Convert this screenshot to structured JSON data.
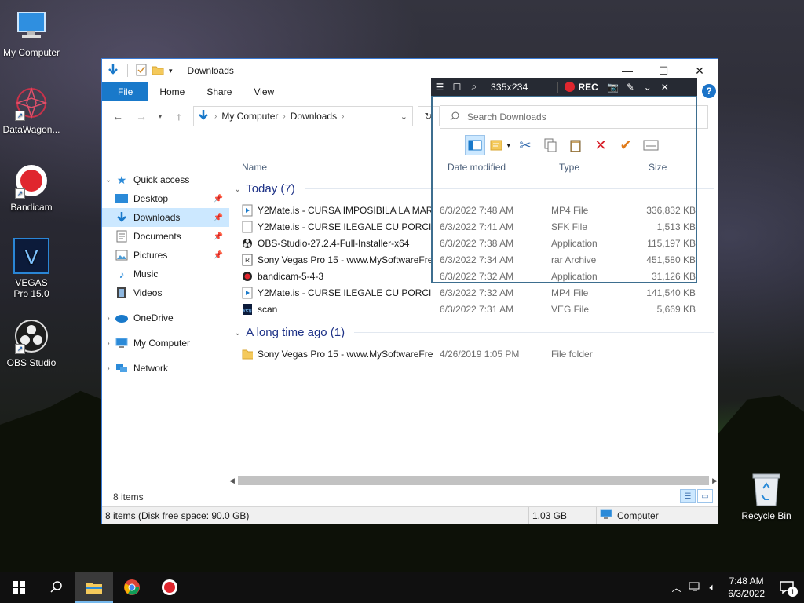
{
  "desktop": {
    "icons": [
      {
        "label": "My Computer"
      },
      {
        "label": "DataWagon..."
      },
      {
        "label": "Bandicam"
      },
      {
        "label": "VEGAS Pro 15.0"
      },
      {
        "label": "OBS Studio"
      }
    ],
    "recycle_bin": "Recycle Bin"
  },
  "explorer": {
    "title": "Downloads",
    "ribbon_tabs": [
      "File",
      "Home",
      "Share",
      "View"
    ],
    "address": [
      "My Computer",
      "Downloads"
    ],
    "search_placeholder": "Search Downloads",
    "sidebar": {
      "quick_access": "Quick access",
      "quick_items": [
        "Desktop",
        "Downloads",
        "Documents",
        "Pictures",
        "Music",
        "Videos"
      ],
      "onedrive": "OneDrive",
      "my_computer": "My Computer",
      "network": "Network"
    },
    "columns": {
      "name": "Name",
      "date": "Date modified",
      "type": "Type",
      "size": "Size"
    },
    "groups": [
      {
        "label": "Today (7)",
        "files": [
          {
            "name": "Y2Mate.is - CURSA IMPOSIBILA LA MARE...",
            "date": "6/3/2022 7:48 AM",
            "type": "MP4 File",
            "size": "336,832 KB",
            "icon": "video-file-icon"
          },
          {
            "name": "Y2Mate.is - CURSE ILEGALE CU PORCI A...",
            "date": "6/3/2022 7:41 AM",
            "type": "SFK File",
            "size": "1,513 KB",
            "icon": "blank-file-icon"
          },
          {
            "name": "OBS-Studio-27.2.4-Full-Installer-x64",
            "date": "6/3/2022 7:38 AM",
            "type": "Application",
            "size": "115,197 KB",
            "icon": "obs-app-icon"
          },
          {
            "name": "Sony Vegas Pro 15 - www.MySoftwareFre...",
            "date": "6/3/2022 7:34 AM",
            "type": "rar Archive",
            "size": "451,580 KB",
            "icon": "rar-archive-icon"
          },
          {
            "name": "bandicam-5-4-3",
            "date": "6/3/2022 7:32 AM",
            "type": "Application",
            "size": "31,126 KB",
            "icon": "bandicam-app-icon"
          },
          {
            "name": "Y2Mate.is - CURSE ILEGALE CU PORCI A...",
            "date": "6/3/2022 7:32 AM",
            "type": "MP4 File",
            "size": "141,540 KB",
            "icon": "video-file-icon"
          },
          {
            "name": "scan",
            "date": "6/3/2022 7:31 AM",
            "type": "VEG File",
            "size": "5,669 KB",
            "icon": "veg-file-icon"
          }
        ]
      },
      {
        "label": "A long time ago (1)",
        "files": [
          {
            "name": "Sony Vegas Pro 15 - www.MySoftwareFre...",
            "date": "4/26/2019 1:05 PM",
            "type": "File folder",
            "size": "",
            "icon": "folder-icon"
          }
        ]
      }
    ],
    "status_count": "8 items",
    "bottom": {
      "summary": "8 items (Disk free space: 90.0 GB)",
      "size": "1.03 GB",
      "location": "Computer"
    }
  },
  "bandicam": {
    "resolution": "335x234",
    "rec_label": "REC",
    "help": "?"
  },
  "taskbar": {
    "time": "7:48 AM",
    "date": "6/3/2022",
    "notification_count": "1"
  },
  "colors": {
    "accent": "#1979ca",
    "selection": "#cce8ff",
    "group_header": "#1e3287",
    "rec_red": "#e0262e",
    "bandicam_frame": "#3d6e8f"
  }
}
